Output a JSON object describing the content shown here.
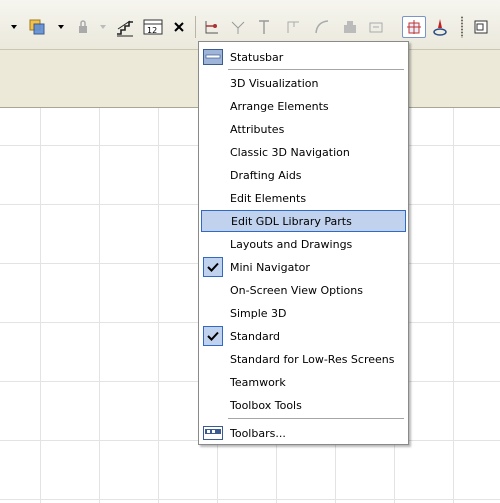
{
  "menu": {
    "items": [
      {
        "label": "Statusbar",
        "checked": false,
        "icon": "statusbar-icon"
      },
      {
        "label": "3D Visualization",
        "checked": false
      },
      {
        "label": "Arrange Elements",
        "checked": false
      },
      {
        "label": "Attributes",
        "checked": false
      },
      {
        "label": "Classic 3D Navigation",
        "checked": false
      },
      {
        "label": "Drafting Aids",
        "checked": false
      },
      {
        "label": "Edit Elements",
        "checked": false
      },
      {
        "label": "Edit GDL Library Parts",
        "checked": false,
        "highlighted": true
      },
      {
        "label": "Layouts and Drawings",
        "checked": false
      },
      {
        "label": "Mini Navigator",
        "checked": true
      },
      {
        "label": "On-Screen View Options",
        "checked": false
      },
      {
        "label": "Simple 3D",
        "checked": false
      },
      {
        "label": "Standard",
        "checked": true
      },
      {
        "label": "Standard for Low-Res Screens",
        "checked": false
      },
      {
        "label": "Teamwork",
        "checked": false
      },
      {
        "label": "Toolbox Tools",
        "checked": false
      },
      {
        "label": "Toolbars...",
        "checked": false,
        "icon": "toolbars-icon"
      }
    ]
  },
  "toolbar": {
    "numbering_icon_text": "12"
  },
  "colors": {
    "highlight_fill": "#c1d2ee",
    "highlight_border": "#316ac5",
    "toolbar_bg": "#ece9d8"
  }
}
